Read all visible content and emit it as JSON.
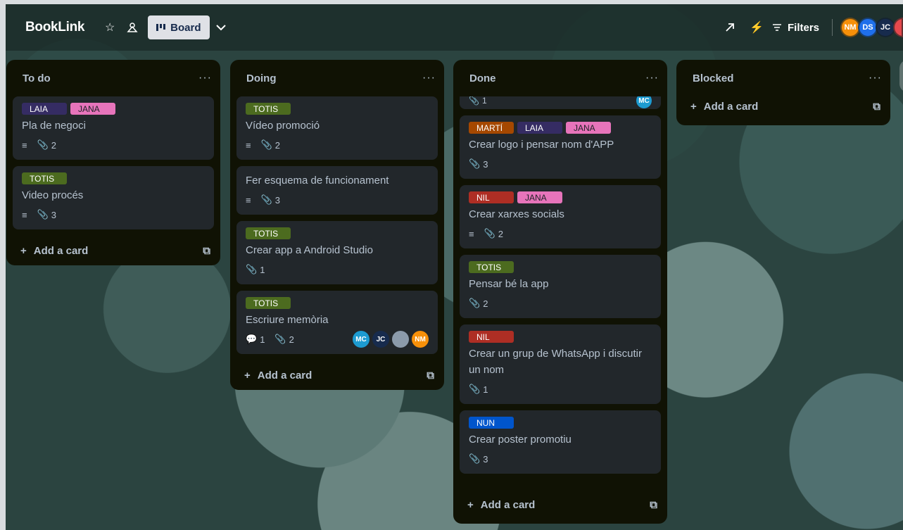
{
  "header": {
    "board_title": "BookLink",
    "view_label": "Board",
    "filters_label": "Filters",
    "avatars": [
      {
        "initials": "NM",
        "color": "#f79009"
      },
      {
        "initials": "DS",
        "color": "#1f6feb"
      },
      {
        "initials": "JC",
        "color": "#172b4d"
      }
    ]
  },
  "add_card_label": "Add a card",
  "lists": [
    {
      "title": "To do",
      "cards": [
        {
          "labels": [
            {
              "text": "LAIA",
              "color": "purple"
            },
            {
              "text": "JANA",
              "color": "pink"
            }
          ],
          "title": "Pla de negoci",
          "description": true,
          "attachments": "2"
        },
        {
          "labels": [
            {
              "text": "TOTIS",
              "color": "green"
            }
          ],
          "title": "Video procés",
          "description": true,
          "attachments": "3"
        }
      ]
    },
    {
      "title": "Doing",
      "cards": [
        {
          "labels": [
            {
              "text": "TOTIS",
              "color": "green"
            }
          ],
          "title": "Vídeo promoció",
          "description": true,
          "attachments": "2"
        },
        {
          "labels": [],
          "title": "Fer esquema de funcionament",
          "description": true,
          "attachments": "3"
        },
        {
          "labels": [
            {
              "text": "TOTIS",
              "color": "green"
            }
          ],
          "title": "Crear app a Android Studio",
          "description": false,
          "attachments": "1"
        },
        {
          "labels": [
            {
              "text": "TOTIS",
              "color": "green"
            }
          ],
          "title": "Escriure memòria",
          "comments": "1",
          "attachments": "2",
          "members": [
            {
              "initials": "MC",
              "color": "#1d9bd1"
            },
            {
              "initials": "JC",
              "color": "#172b4d"
            },
            {
              "initials": "",
              "color": "#8c9bab"
            },
            {
              "initials": "NM",
              "color": "#f79009"
            }
          ]
        }
      ]
    },
    {
      "title": "Done",
      "partial_card": {
        "attachments": "1",
        "member": "MC"
      },
      "cards": [
        {
          "labels": [
            {
              "text": "MARTÍ",
              "color": "orange"
            },
            {
              "text": "LAIA",
              "color": "purple"
            },
            {
              "text": "JANA",
              "color": "pink"
            }
          ],
          "title": "Crear logo i pensar nom d'APP",
          "description": false,
          "attachments": "3"
        },
        {
          "labels": [
            {
              "text": "NIL",
              "color": "red"
            },
            {
              "text": "JANA",
              "color": "pink"
            }
          ],
          "title": "Crear xarxes socials",
          "description": true,
          "attachments": "2"
        },
        {
          "labels": [
            {
              "text": "TOTIS",
              "color": "green"
            }
          ],
          "title": "Pensar bé la app",
          "description": false,
          "attachments": "2"
        },
        {
          "labels": [
            {
              "text": "NIL",
              "color": "red"
            }
          ],
          "title": "Crear un grup de WhatsApp i discutir un nom",
          "description": false,
          "attachments": "1"
        },
        {
          "labels": [
            {
              "text": "NUN",
              "color": "blue"
            }
          ],
          "title": "Crear poster promotiu",
          "description": false,
          "attachments": "3"
        }
      ]
    },
    {
      "title": "Blocked",
      "cards": []
    }
  ]
}
